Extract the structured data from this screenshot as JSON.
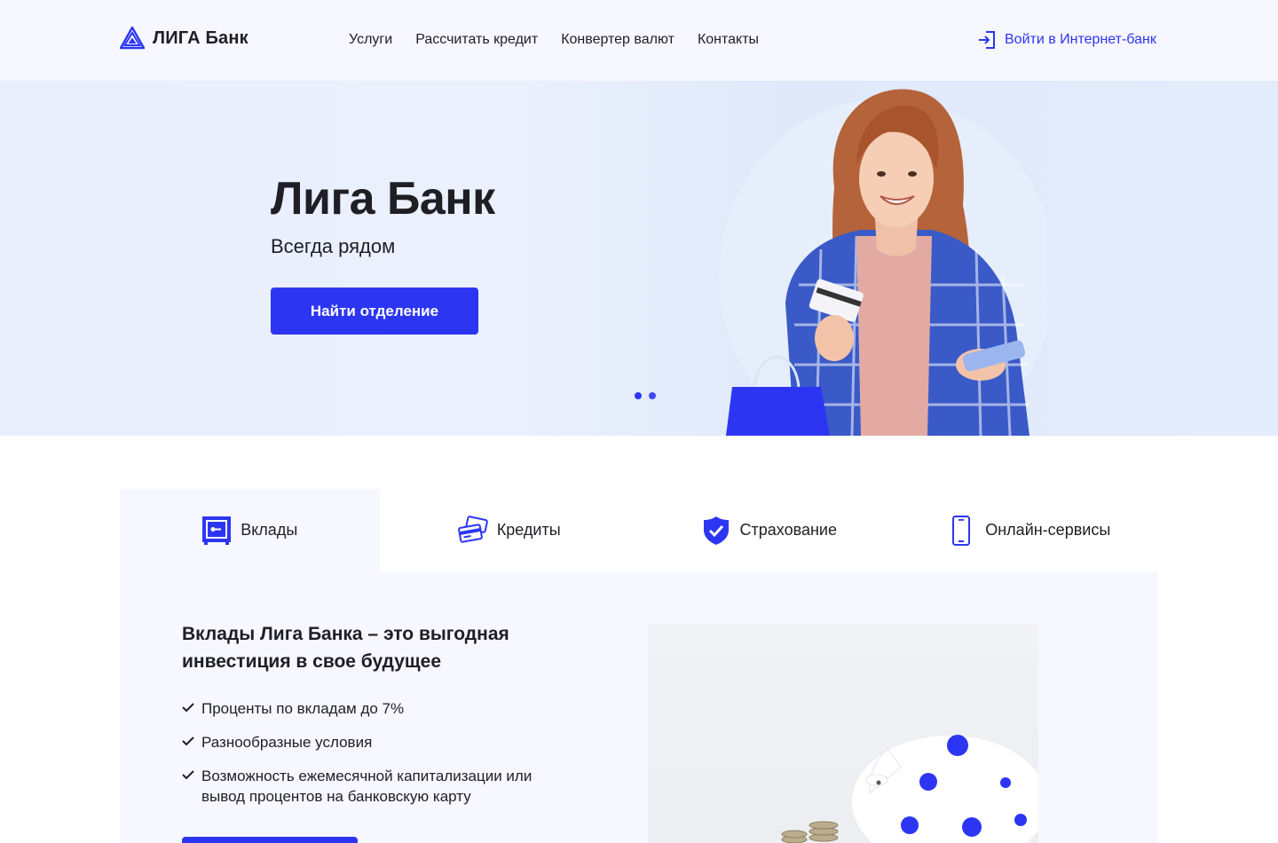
{
  "header": {
    "logo_text": "ЛИГА Банк",
    "nav": [
      "Услуги",
      "Рассчитать кредит",
      "Конвертер валют",
      "Контакты"
    ],
    "login_label": "Войти в Интернет-банк"
  },
  "hero": {
    "title": "Лига Банк",
    "subtitle": "Всегда рядом",
    "button_label": "Найти отделение",
    "slides_count": 2
  },
  "tabs": [
    {
      "label": "Вклады",
      "icon": "vault-icon",
      "active": true
    },
    {
      "label": "Кредиты",
      "icon": "cards-icon",
      "active": false
    },
    {
      "label": "Страхование",
      "icon": "shield-check-icon",
      "active": false
    },
    {
      "label": "Онлайн-сервисы",
      "icon": "phone-icon",
      "active": false
    }
  ],
  "panel": {
    "title": "Вклады Лига Банка – это выгодная инвестиция в свое будущее",
    "features": [
      "Проценты по вкладам до 7%",
      "Разнообразные условия",
      "Возможность ежемесячной капитализации или вывод процентов на банковскую карту"
    ]
  },
  "colors": {
    "accent": "#2c36f2",
    "text": "#1f1e25",
    "panel_bg": "#f6f7ff"
  }
}
